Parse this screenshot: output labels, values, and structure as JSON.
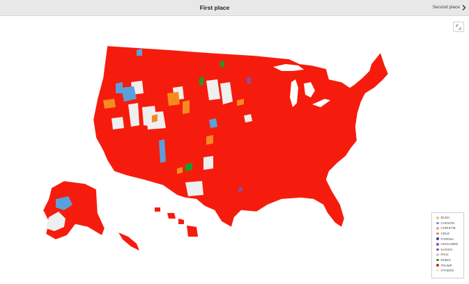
{
  "header": {
    "title": "First place",
    "next_label": "Second place",
    "next_icon": "chevron-right-icon",
    "expand_icon": "expand-icon"
  },
  "colors": {
    "bar_background": "#e8e8e8",
    "map_fill": "#f61c0d",
    "no_data": "#efefef"
  },
  "legend": {
    "items": [
      {
        "label": "BUSH",
        "color": "#f3c56a"
      },
      {
        "label": "CARSON",
        "color": "#5aa0dc"
      },
      {
        "label": "CHRISTIE",
        "color": "#f2a09c"
      },
      {
        "label": "CRUZ",
        "color": "#f58b1f"
      },
      {
        "label": "FIORINA",
        "color": "#2a4f9c"
      },
      {
        "label": "HUCKABEE",
        "color": "#9c4fc9"
      },
      {
        "label": "KASICH",
        "color": "#8b4f9c"
      },
      {
        "label": "PAUL",
        "color": "#c8c8c8"
      },
      {
        "label": "RUBIO",
        "color": "#1a9c2a"
      },
      {
        "label": "TRUMP",
        "color": "#d82a1a"
      },
      {
        "label": "OTHERS",
        "color": "#f5d9c9"
      }
    ]
  }
}
